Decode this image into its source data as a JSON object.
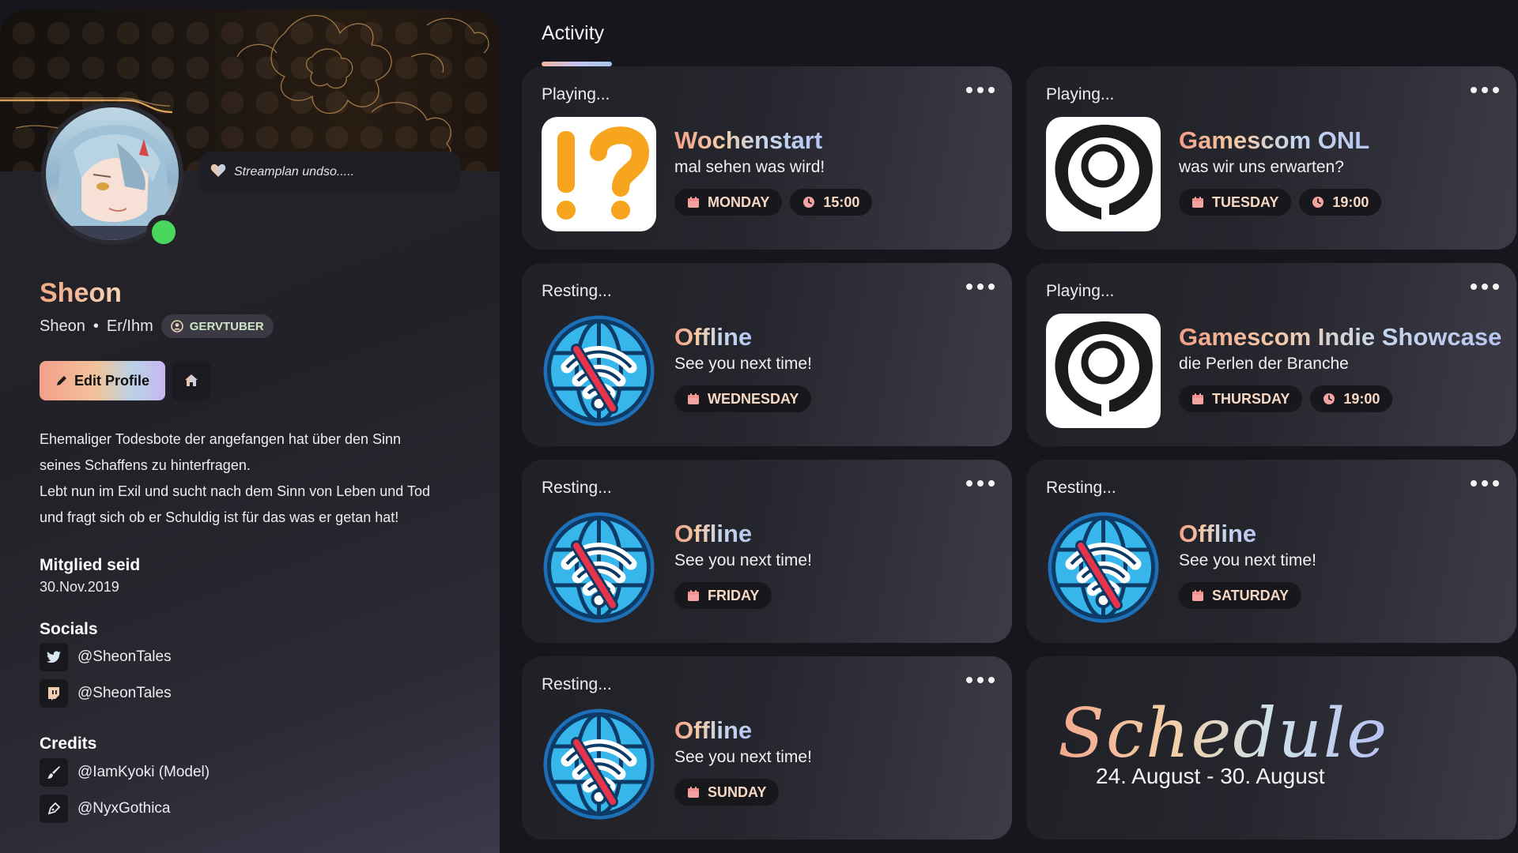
{
  "profile": {
    "status_text": "Streamplan undso.....",
    "name": "Sheon",
    "display_name": "Sheon",
    "pronouns": "Er/Ihm",
    "badge": "GERVTUBER",
    "edit_button": "Edit Profile",
    "bio": [
      "Ehemaliger Todesbote der angefangen hat über den Sinn",
      "seines Schaffens zu hinterfragen.",
      "Lebt nun im Exil und sucht nach dem Sinn von Leben und Tod",
      "und fragt sich ob er Schuldig ist für das was er getan hat!"
    ],
    "member_since_label": "Mitglied seid",
    "member_since_value": "30.Nov.2019",
    "socials_label": "Socials",
    "socials": [
      {
        "icon": "twitter-icon",
        "handle": "@SheonTales"
      },
      {
        "icon": "twitch-icon",
        "handle": "@SheonTales"
      }
    ],
    "credits_label": "Credits",
    "credits": [
      {
        "icon": "brush-icon",
        "text": "@IamKyoki (Model)"
      },
      {
        "icon": "pen-icon",
        "text": "@NyxGothica"
      }
    ]
  },
  "activity": {
    "title": "Activity",
    "cards": [
      {
        "status": "Playing...",
        "icon": "question-exclamation-icon",
        "title": "Wochenstart",
        "subtitle": "mal sehen was wird!",
        "day": "MONDAY",
        "time": "15:00"
      },
      {
        "status": "Playing...",
        "icon": "gamescom-icon",
        "title": "Gamescom ONL",
        "subtitle": "was wir uns erwarten?",
        "day": "TUESDAY",
        "time": "19:00"
      },
      {
        "status": "Resting...",
        "icon": "offline-globe-icon",
        "title": "Offline",
        "subtitle": "See you next time!",
        "day": "WEDNESDAY",
        "time": null
      },
      {
        "status": "Playing...",
        "icon": "gamescom-icon",
        "title": "Gamescom Indie Showcase",
        "subtitle": "die Perlen der Branche",
        "day": "THURSDAY",
        "time": "19:00"
      },
      {
        "status": "Resting...",
        "icon": "offline-globe-icon",
        "title": "Offline",
        "subtitle": "See you next time!",
        "day": "FRIDAY",
        "time": null
      },
      {
        "status": "Resting...",
        "icon": "offline-globe-icon",
        "title": "Offline",
        "subtitle": "See you next time!",
        "day": "SATURDAY",
        "time": null
      },
      {
        "status": "Resting...",
        "icon": "offline-globe-icon",
        "title": "Offline",
        "subtitle": "See you next time!",
        "day": "SUNDAY",
        "time": null
      }
    ],
    "schedule": {
      "title": "Schedule",
      "range": "24. August - 30. August"
    }
  },
  "colors": {
    "background": "#16161c",
    "online_status": "#4ad85c",
    "pill_text": "#f7d8c4",
    "calendar_icon": "#f4a3a3"
  }
}
